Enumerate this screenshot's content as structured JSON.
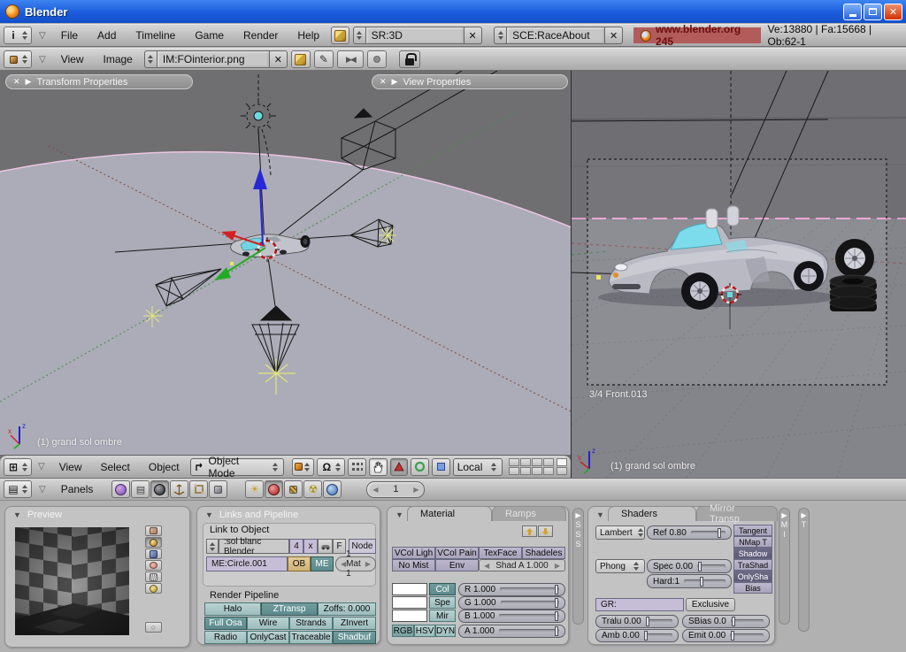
{
  "window": {
    "title": "Blender"
  },
  "icons": {
    "collapse": "▽",
    "x": "✕",
    "play": "▶",
    "left": "◀",
    "right": "▶",
    "tri": "▼",
    "pencil": "✎",
    "omega": "Ω",
    "sun": "☀",
    "radiation": "☢",
    "info": "i",
    "grid": "⊞",
    "rows": "▤",
    "mode_arrow": "�racked",
    "circle": "○",
    "bowtie": "▶◀"
  },
  "top": {
    "menus": [
      "File",
      "Add",
      "Timeline",
      "Game",
      "Render",
      "Help"
    ],
    "screen": "SR:3D",
    "scene": "SCE:RaceAbout",
    "badge": "www.blender.org 245",
    "stats": "Ve:13880 | Fa:15668 | Ob:62-1"
  },
  "image_bar": {
    "menus": [
      "View",
      "Image"
    ],
    "image": "IM:FOinterior.png"
  },
  "left_vp": {
    "transform_props": "Transform Properties",
    "view_props": "View Properties",
    "label": "(1) grand sol ombre"
  },
  "right_vp": {
    "camera": "3/4 Front.013",
    "label": "(1) grand sol ombre"
  },
  "vp_header": {
    "menus": [
      "View",
      "Select",
      "Object"
    ],
    "mode": "Object Mode",
    "orientation": "Local"
  },
  "buttons_header": {
    "panels": "Panels",
    "frame": "1"
  },
  "preview": {
    "title": "Preview"
  },
  "links": {
    "title": "Links and Pipeline",
    "group_label": "Link to Object",
    "mat_name": ":sol blanc Blender",
    "users": "4",
    "unlink": "x",
    "fake": "F",
    "node": "Node",
    "mesh": "ME:Circle.001",
    "ob": "OB",
    "me": "ME",
    "mat_idx": "1 Mat 1",
    "pipeline_label": "Render Pipeline",
    "r1": [
      "Halo",
      "ZTransp",
      "Zoffs: 0.000"
    ],
    "r2": [
      "Full Osa",
      "Wire",
      "Strands",
      "ZInvert"
    ],
    "r3": [
      "Radio",
      "OnlyCast",
      "Traceable",
      "Shadbuf"
    ]
  },
  "material": {
    "tab_active": "Material",
    "tab_inactive": "Ramps",
    "r1": [
      "VCol Ligh",
      "VCol Pain",
      "TexFace",
      "Shadeles"
    ],
    "no_mist": "No Mist",
    "env": "Env",
    "shad_a": "Shad A 1.000",
    "col": "Col",
    "spe": "Spe",
    "mir": "Mir",
    "rgb": "RGB",
    "hsv": "HSV",
    "dyn": "DYN",
    "sliders": [
      "R 1.000",
      "G 1.000",
      "B 1.000",
      "A 1.000"
    ]
  },
  "sss": {
    "letters": [
      "S",
      "S",
      "S"
    ]
  },
  "shaders": {
    "tab_active": "Shaders",
    "tab_inactive": "Mirror Transp",
    "diffuse": "Lambert",
    "ref": "Ref  0.80",
    "toggles": [
      "Tangent",
      "NMap T",
      "Shadow",
      "TraShad",
      "OnlySha",
      "Bias"
    ],
    "specular": "Phong",
    "spec": "Spec 0.00",
    "hard": "Hard:1",
    "gr": "GR:",
    "exclusive": "Exclusive",
    "tralu": "Tralu 0.00",
    "sbias": "SBias 0.0",
    "amb": "Amb 0.00",
    "emit": "Emit 0.00"
  },
  "collapsed": {
    "mi": [
      "M",
      "I"
    ],
    "t": [
      "T"
    ]
  }
}
